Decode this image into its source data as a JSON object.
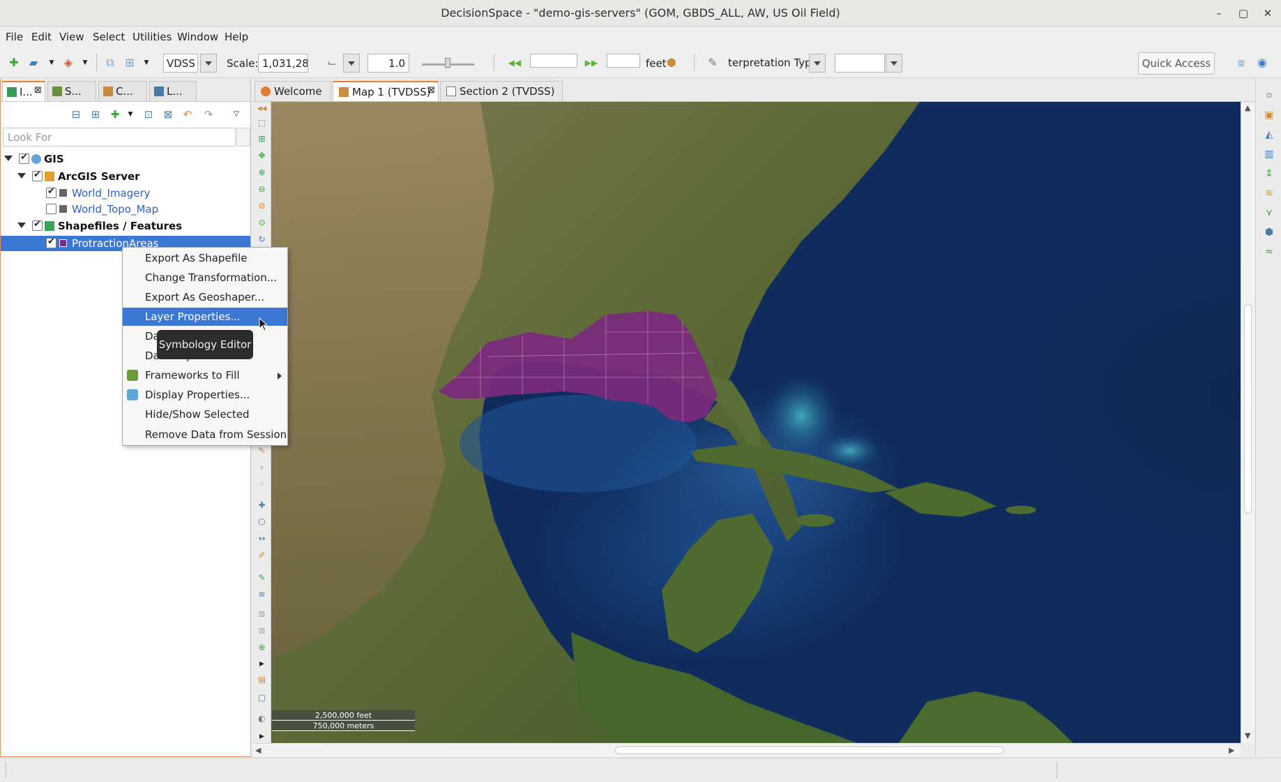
{
  "window": {
    "title": "DecisionSpace - \"demo-gis-servers\" (GOM, GBDS_ALL, AW, US Oil Field)",
    "controls": [
      "–",
      "▢",
      "✕"
    ]
  },
  "menubar": [
    "File",
    "Edit",
    "View",
    "Select",
    "Utilities",
    "Window",
    "Help"
  ],
  "toolbar": {
    "datum_value": "VDSS",
    "scale_label": "Scale:",
    "scale_value": "1,031,28",
    "ratio_value": "1.0",
    "units_label": "feet",
    "interp_type_value": "terpretation Type",
    "quick_access_label": "Quick Access"
  },
  "left_panel": {
    "tabs": [
      {
        "label": "I...",
        "closable": true
      },
      {
        "label": "S..."
      },
      {
        "label": "C..."
      },
      {
        "label": "L..."
      }
    ],
    "search_placeholder": "Look For",
    "tree": [
      {
        "label": "GIS",
        "level": 0,
        "checked": true,
        "expanded": true
      },
      {
        "label": "ArcGIS Server",
        "level": 1,
        "checked": true,
        "expanded": true
      },
      {
        "label": "World_Imagery",
        "level": 2,
        "checked": true
      },
      {
        "label": "World_Topo_Map",
        "level": 2,
        "checked": false
      },
      {
        "label": "Shapefiles / Features",
        "level": 1,
        "checked": true,
        "expanded": true
      },
      {
        "label": "ProtractionAreas",
        "level": 2,
        "checked": true,
        "selected": true
      }
    ]
  },
  "editor_tabs": [
    {
      "label": "Welcome"
    },
    {
      "label": "Map 1 (TVDSS)",
      "active": true,
      "closable": true
    },
    {
      "label": "Section 2 (TVDSS)"
    }
  ],
  "context_menu": {
    "items": [
      {
        "label": "Export As Shapefile"
      },
      {
        "label": "Change Transformation..."
      },
      {
        "label": "Export As Geoshaper..."
      },
      {
        "label": "Layer Properties...",
        "highlighted": true
      },
      {
        "label": "Data Import"
      },
      {
        "label": "Data Export"
      },
      {
        "label": "Frameworks to Fill",
        "submenu": true
      },
      {
        "label": "Display Properties..."
      },
      {
        "label": "Hide/Show Selected"
      },
      {
        "label": "Remove Data from Session"
      }
    ],
    "tooltip": "Symbology Editor"
  },
  "map": {
    "scalebar_feet": "2,500,000 feet",
    "scalebar_meters": "750,000 meters",
    "layer_color": "#7b2a7d",
    "ocean_color": "#0f2c5c"
  },
  "colors": {
    "accent": "#e27d2f",
    "selection": "#3a78d4",
    "link": "#2d62c0"
  }
}
